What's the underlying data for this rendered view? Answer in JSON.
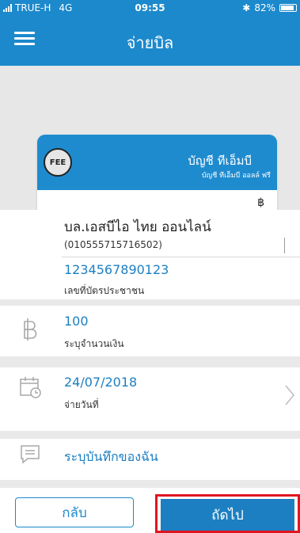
{
  "status_bar": {
    "carrier": "TRUE-H",
    "network": "4G",
    "time": "09:55",
    "battery": "82%"
  },
  "header": {
    "title": "จ่ายบิล"
  },
  "card": {
    "badge": "FEE",
    "account_name": "บัญชี ทีเอ็มบี",
    "account_type": "บัญชี ทีเอ็มบี ออลล์ ฟรี",
    "currency_symbol": "฿"
  },
  "biller": {
    "name": "บล.เอสบีไอ ไทย ออนไลน์",
    "id": "(010555715716502)",
    "reference_value": "1234567890123",
    "reference_label": "เลขที่บัตรประชาชน"
  },
  "amount": {
    "value": "100",
    "label": "ระบุจำนวนเงิน",
    "icon": "baht-icon"
  },
  "date": {
    "value": "24/07/2018",
    "label": "จ่ายวันที่",
    "icon": "calendar-icon"
  },
  "note": {
    "label": "ระบุบันทึกของฉัน",
    "icon": "note-bubble-icon"
  },
  "buttons": {
    "back": "กลับ",
    "next": "ถัดไป"
  },
  "colors": {
    "brand": "#1c89cc",
    "highlight": "#e0161f"
  }
}
